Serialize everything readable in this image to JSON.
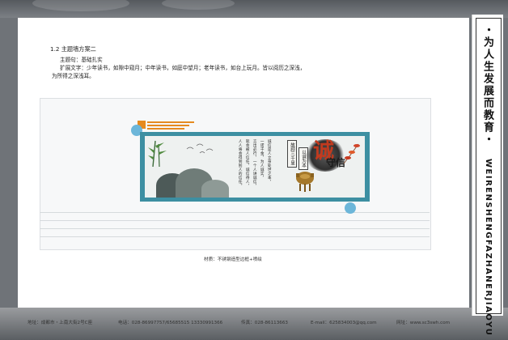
{
  "heading": "1.2 主题墙方案二",
  "theme_line": "主题句：基础扎实",
  "expand_line1": "扩展文字：少年读书，如隙中窥月；中年读书，如庭中望月；老年读书，如台上玩月。皆以阅历之深浅，",
  "expand_line2": "为所得之深浅耳。",
  "panel": {
    "big_char": "诚",
    "small_char": "守信",
    "box_text_1": "故顾三千里",
    "box_text_2": "以诚为本",
    "columns": [
      "诚信是人立身处世之本，",
      "一诺千金，为人诚实，",
      "言出必行，一个人讲诚信，",
      "就会被人信任，诚信待人，",
      "人人将会得到别人的信任。"
    ]
  },
  "caption": "材质：不锈钢造型边框+喷绘",
  "footer": {
    "address": "地址：成都市・上南大街2号C座",
    "phone": "电话：028-86997757/65685515  13330991366",
    "fax": "传真：028-86113663",
    "email": "E-mail：625834003@qq.com",
    "website": "网址：www.sc3swh.com"
  },
  "sidebar": {
    "slogan": "・为人生发展而教育・",
    "pinyin": "WEIRENSHENGFAZHANERJIAOYU"
  },
  "colors": {
    "frame": "#3d8fa2",
    "accent_orange": "#e58a1f",
    "accent_blue": "#6cb6d9",
    "seal_red": "#c23a1e"
  }
}
